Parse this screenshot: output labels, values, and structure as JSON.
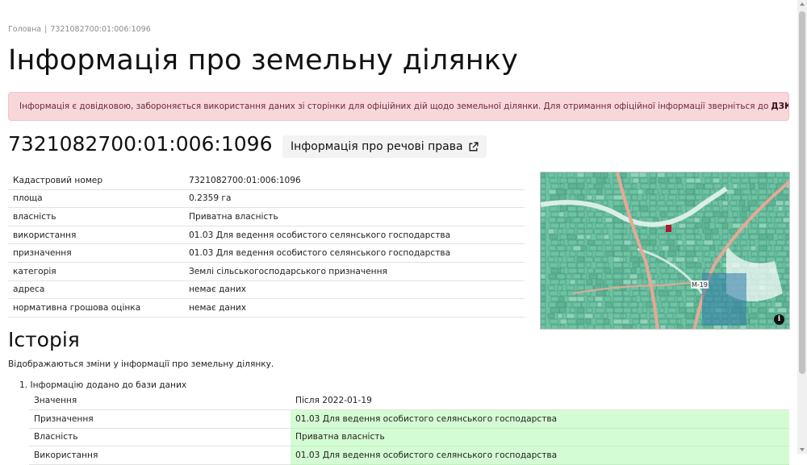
{
  "breadcrumb": {
    "home": "Головна",
    "separator": "|",
    "current": "7321082700:01:006:1096"
  },
  "page_title": "Інформація про земельну ділянку",
  "alert": {
    "text": "Інформація є довідковою, забороняється використання даних зі сторінки для офіційних дій щодо земельної ділянки. Для отримання офіційної інформації зверніться до",
    "link": "ДЗК",
    "tail": "."
  },
  "cadastral": {
    "number": "7321082700:01:006:1096",
    "rights_button": "Інформація про речові права"
  },
  "info": [
    {
      "key": "Кадастровий номер",
      "value": "7321082700:01:006:1096"
    },
    {
      "key": "площа",
      "value": "0.2359 га"
    },
    {
      "key": "власність",
      "value": "Приватна власність"
    },
    {
      "key": "використання",
      "value": "01.03 Для ведення особистого селянського господарства"
    },
    {
      "key": "призначення",
      "value": "01.03 Для ведення особистого селянського господарства"
    },
    {
      "key": "категорія",
      "value": "Землі сільськогосподарського призначення"
    },
    {
      "key": "адреса",
      "value": "немає даних"
    },
    {
      "key": "нормативна грошова оцінка",
      "value": "немає даних"
    }
  ],
  "map": {
    "road_label": "М-19",
    "info_symbol": "i"
  },
  "history": {
    "title": "Історія",
    "description": "Відображаються зміни у інформації про земельну ділянку.",
    "items": [
      {
        "number": "1.",
        "title": "Інформацію додано до бази даних",
        "header": {
          "key": "Значення",
          "value": "Після 2022-01-19"
        },
        "rows": [
          {
            "key": "Призначення",
            "value": "01.03 Для ведення особистого селянського господарства"
          },
          {
            "key": "Власність",
            "value": "Приватна власність"
          },
          {
            "key": "Використання",
            "value": "01.03 Для ведення особистого селянського господарства"
          }
        ]
      }
    ]
  },
  "colors": {
    "alert_bg": "#f8d7da",
    "added_bg": "#d4fcd4",
    "map_base": "#6fc3a3",
    "road": "#e8a894",
    "selected_parcel": "#b0192b"
  }
}
